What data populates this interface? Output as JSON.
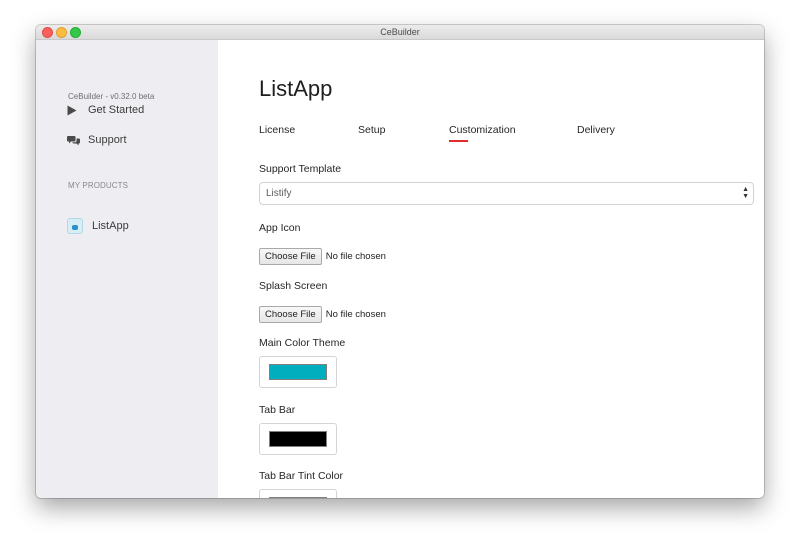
{
  "window": {
    "title": "CeBuilder"
  },
  "sidebar": {
    "version": "CeBuilder - v0.32.0 beta",
    "items": [
      {
        "label": "Get Started",
        "icon": "play-icon"
      },
      {
        "label": "Support",
        "icon": "chat-bubbles-icon"
      }
    ],
    "section_title": "MY PRODUCTS",
    "products": [
      {
        "label": "ListApp",
        "icon": "app-thumbnail-icon"
      }
    ]
  },
  "main": {
    "title": "ListApp",
    "tabs": [
      {
        "label": "License",
        "active": false
      },
      {
        "label": "Setup",
        "active": false
      },
      {
        "label": "Customization",
        "active": true
      },
      {
        "label": "Delivery",
        "active": false
      }
    ],
    "form": {
      "support_template": {
        "label": "Support Template",
        "value": "Listify"
      },
      "app_icon": {
        "label": "App Icon",
        "button": "Choose File",
        "status": "No file chosen"
      },
      "splash_screen": {
        "label": "Splash Screen",
        "button": "Choose File",
        "status": "No file chosen"
      },
      "main_color_theme": {
        "label": "Main Color Theme",
        "color": "#00aebd"
      },
      "tab_bar": {
        "label": "Tab Bar",
        "color": "#000000"
      },
      "tab_bar_tint_color": {
        "label": "Tab Bar Tint Color",
        "color": "#1a9aa8"
      }
    }
  },
  "colors": {
    "accent_underline": "#e32b2b",
    "sidebar_bg": "#eeeef2"
  }
}
